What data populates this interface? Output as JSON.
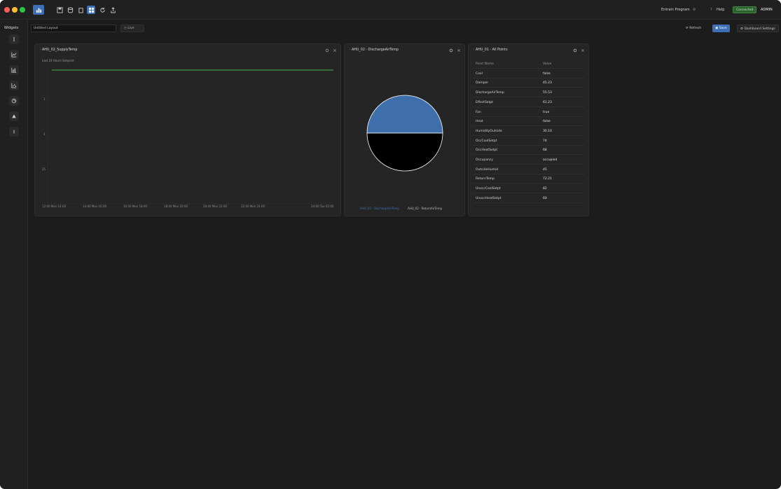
{
  "window": {
    "traffic_lights": [
      "#ff5f57",
      "#febc2e",
      "#28c840"
    ]
  },
  "titlebar": {
    "active_tool_icon": "dashboard-icon",
    "tools": [
      "save-icon",
      "database-icon",
      "copy-icon",
      "grid-icon",
      "refresh-icon",
      "share-icon"
    ],
    "user_label": "Entrain Program",
    "help_label": "Help",
    "status_badge": "Connected",
    "account_label": "ADMIN",
    "accent_color": "#3d6fb6",
    "status_color": "#3c8c3c"
  },
  "rail": {
    "title": "Widgets",
    "items": [
      "text-icon",
      "line-chart-icon",
      "bar-chart-icon",
      "scatter-icon",
      "pie-chart-icon",
      "table-icon",
      "divider-icon"
    ]
  },
  "toolbar": {
    "dashboard_name": "Untitled Layout",
    "time_button": "Live",
    "reset_label": "Refresh",
    "save_label": "Save",
    "settings_label": "Dashboard Settings"
  },
  "widget1": {
    "title": "AHU_02_SupplyTemp",
    "legend": "Last 24 Hours   Setpoint",
    "line_color": "#4caf50",
    "y_ticks": [
      "1",
      "4",
      "25"
    ],
    "x_ticks": [
      "12:00 Mon 14:00",
      "14:00 Mon 16:00",
      "16:00 Mon 18:00",
      "18:00 Mon 20:00",
      "20:00 Mon 22:00",
      "22:00 Mon 24:00",
      "24:00 Tue 02:00"
    ]
  },
  "widget2": {
    "title": "AHU_02 - DischargeAirTemp",
    "legend_left": "AHU_02 - DischargeAirTemp",
    "legend_right": "AHU_02 - ReturnAirTemp",
    "slice_colors": [
      "#3e6fab",
      "#000000"
    ],
    "chart_data": {
      "type": "pie",
      "categories": [
        "AHU_02 - DischargeAirTemp",
        "AHU_02 - ReturnAirTemp"
      ],
      "values": [
        50,
        50
      ]
    }
  },
  "widget3": {
    "title": "AHU_01 - All Points",
    "headers": [
      "Point Name",
      "Value"
    ],
    "rows": [
      [
        "Cool",
        "false"
      ],
      [
        "Damper",
        "45.23"
      ],
      [
        "DischargeAirTemp",
        "55.53"
      ],
      [
        "EffectSetpt",
        "61.23"
      ],
      [
        "Fan",
        "true"
      ],
      [
        "Heat",
        "false"
      ],
      [
        "HumidityOutside",
        "30.10"
      ],
      [
        "OccCoolSetpt",
        "74"
      ],
      [
        "OccHeatSetpt",
        "68"
      ],
      [
        "Occupancy",
        "occupied"
      ],
      [
        "OutsideHumid",
        "45"
      ],
      [
        "ReturnTemp",
        "72.21"
      ],
      [
        "UnoccCoolSetpt",
        "82"
      ],
      [
        "UnoccHeatSetpt",
        "60"
      ]
    ]
  }
}
